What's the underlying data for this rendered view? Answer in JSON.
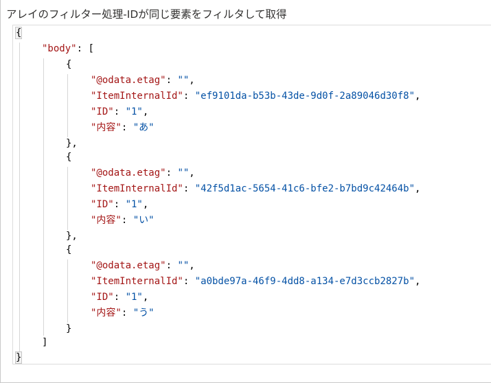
{
  "title": "アレイのフィルター処理-IDが同じ要素をフィルタして取得",
  "code": {
    "open_brace": "{",
    "close_brace": "}",
    "body_key": "\"body\"",
    "array_open": "[",
    "array_close": "]",
    "items": [
      {
        "etag_key": "\"@odata.etag\"",
        "etag_value": "\"\"",
        "item_internal_id_key": "\"ItemInternalId\"",
        "item_internal_id_value": "\"ef9101da-b53b-43de-9d0f-2a89046d30f8\"",
        "id_key": "\"ID\"",
        "id_value": "\"1\"",
        "content_key": "\"内容\"",
        "content_value": "\"あ\""
      },
      {
        "etag_key": "\"@odata.etag\"",
        "etag_value": "\"\"",
        "item_internal_id_key": "\"ItemInternalId\"",
        "item_internal_id_value": "\"42f5d1ac-5654-41c6-bfe2-b7bd9c42464b\"",
        "id_key": "\"ID\"",
        "id_value": "\"1\"",
        "content_key": "\"内容\"",
        "content_value": "\"い\""
      },
      {
        "etag_key": "\"@odata.etag\"",
        "etag_value": "\"\"",
        "item_internal_id_key": "\"ItemInternalId\"",
        "item_internal_id_value": "\"a0bde97a-46f9-4dd8-a134-e7d3ccb2827b\"",
        "id_key": "\"ID\"",
        "id_value": "\"1\"",
        "content_key": "\"内容\"",
        "content_value": "\"う\""
      }
    ]
  },
  "colors": {
    "key": "#a31515",
    "string": "#0451a5",
    "punctuation": "#000000"
  }
}
